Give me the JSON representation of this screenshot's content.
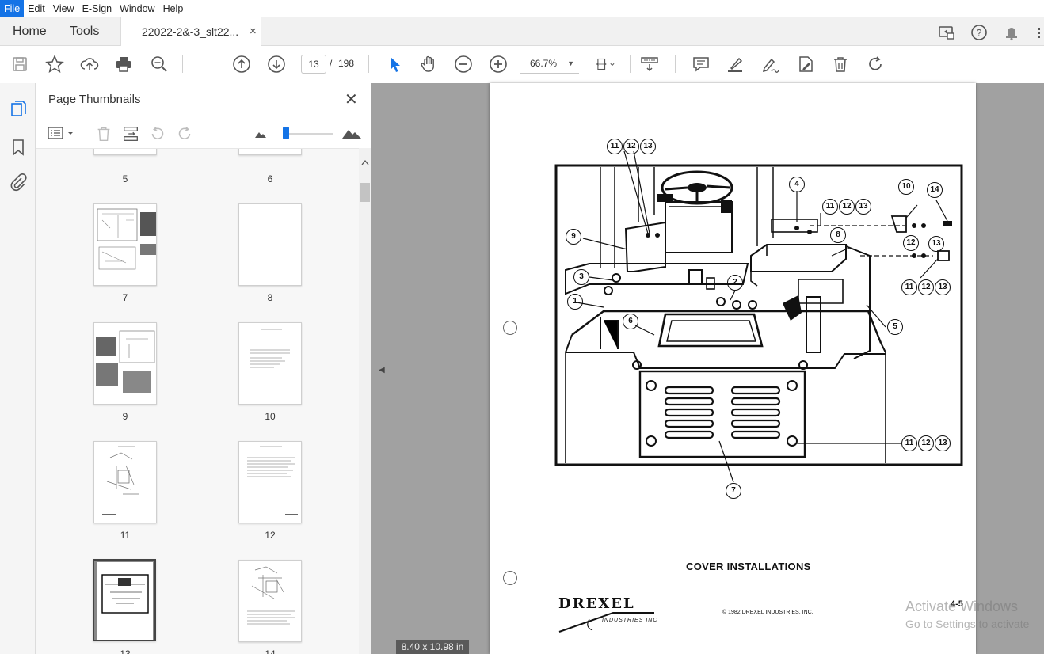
{
  "menubar": {
    "items": [
      "File",
      "Edit",
      "View",
      "E-Sign",
      "Window",
      "Help"
    ]
  },
  "tabs": {
    "home": "Home",
    "tools": "Tools",
    "document": "22022-2&-3_slt22...",
    "close": "×"
  },
  "toolbar": {
    "current_page": "13",
    "page_separator": "/",
    "total_pages": "198",
    "zoom": "66.7%",
    "zoom_dropdown": "▼",
    "icons": [
      "save-icon",
      "star-icon",
      "upload-icon",
      "print-icon",
      "zoom-search-icon",
      "page-up-icon",
      "page-down-icon",
      "select-cursor-icon",
      "hand-icon",
      "zoom-out-icon",
      "zoom-in-icon",
      "fit-page-icon",
      "scroll-mode-icon",
      "comment-icon",
      "highlight-icon",
      "sign-icon",
      "edit-pdf-icon",
      "delete-icon",
      "rotate-icon"
    ]
  },
  "thumbnail_panel": {
    "title": "Page Thumbnails",
    "close": "✕",
    "pages": [
      {
        "num": "5"
      },
      {
        "num": "6"
      },
      {
        "num": "7"
      },
      {
        "num": "8"
      },
      {
        "num": "9"
      },
      {
        "num": "10"
      },
      {
        "num": "11"
      },
      {
        "num": "12"
      },
      {
        "num": "13"
      },
      {
        "num": "14"
      }
    ],
    "current_page": "13"
  },
  "document": {
    "page_size": "8.40 x 10.98 in",
    "figure_title": "COVER INSTALLATIONS",
    "logo": "DREXEL",
    "logo_sub": "INDUSTRIES INC",
    "copyright": "© 1982 DREXEL INDUSTRIES, INC.",
    "page_number": "4-5",
    "callouts": {
      "c1": "1",
      "c2": "2",
      "c3": "3",
      "c4": "4",
      "c5": "5",
      "c6": "6",
      "c7": "7",
      "c8": "8",
      "c9": "9",
      "c10": "10",
      "c11": "11",
      "c12": "12",
      "c13": "13",
      "c14": "14"
    }
  },
  "watermark": {
    "title": "Activate Windows",
    "subtitle": "Go to Settings to activate"
  },
  "colors": {
    "accent": "#1473e6",
    "doc_background": "#a1a1a1"
  }
}
